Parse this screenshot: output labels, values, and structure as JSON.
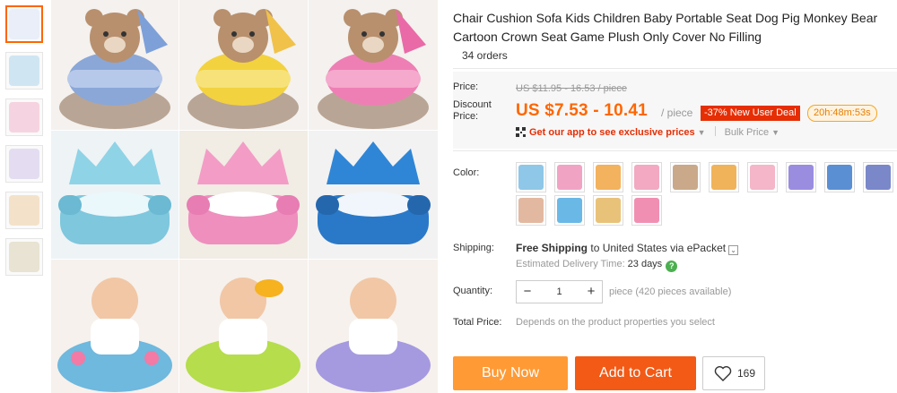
{
  "product": {
    "title": "Chair Cushion Sofa Kids Children Baby Portable Seat Dog Pig Monkey Bear Cartoon Crown Seat Game Plush Only Cover No Filling",
    "orders": "34 orders"
  },
  "price": {
    "price_label": "Price:",
    "original": "US $11.95 - 16.53 / piece",
    "discount_label": "Discount Price:",
    "discount": "US $7.53 - 10.41",
    "per_piece": "/ piece",
    "promo_badge": "-37% New User Deal",
    "timer": "20h:48m:53s",
    "app_promo": "Get our app to see exclusive prices",
    "bulk_price": "Bulk Price"
  },
  "color": {
    "label": "Color:",
    "swatches": [
      "#8fc7e8",
      "#f1a3c4",
      "#f3b25e",
      "#f2a9c1",
      "#c9a98a",
      "#f0b35a",
      "#f4b6c8",
      "#9a8de0",
      "#5b8fd4",
      "#7a88c9",
      "#e2b9a0",
      "#6ab8e6",
      "#e9c27a",
      "#f18fb2"
    ]
  },
  "shipping": {
    "label": "Shipping:",
    "free_text": "Free Shipping",
    "to_text": "to United States via ePacket",
    "estimated_label": "Estimated Delivery Time:",
    "estimated_days": "23 days"
  },
  "quantity": {
    "label": "Quantity:",
    "value": "1",
    "minus": "−",
    "plus": "+",
    "available": "piece (420 pieces available)"
  },
  "total": {
    "label": "Total Price:",
    "value": "Depends on the product properties you select"
  },
  "actions": {
    "buy_now": "Buy Now",
    "add_to_cart": "Add to Cart",
    "wishlist_count": "169"
  },
  "thumbnails": [
    "#e9eef8",
    "#cfe6f2",
    "#f6d3e0",
    "#e4ddf1",
    "#f3e2c9",
    "#e8e3d2"
  ],
  "colors": {
    "accent": "#f60",
    "buy_now": "#ff9a35",
    "add_to_cart": "#f25a16",
    "promo": "#e62e04"
  }
}
